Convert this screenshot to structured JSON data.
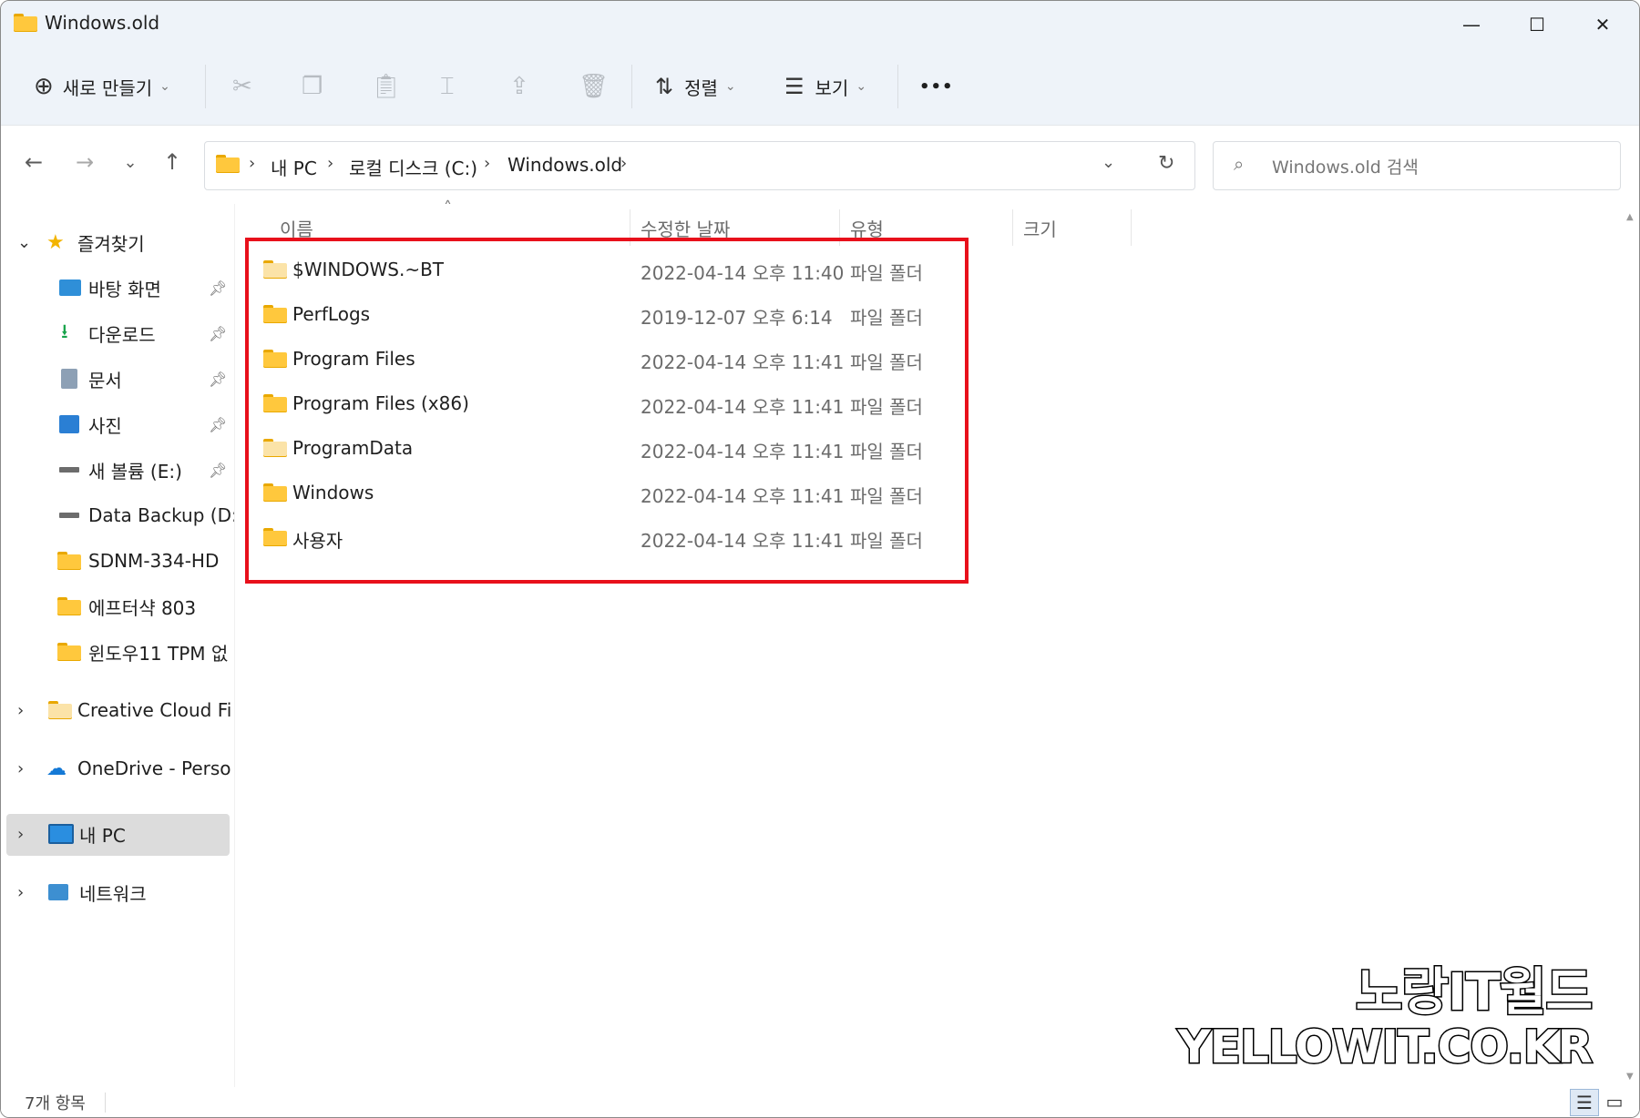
{
  "window": {
    "title": "Windows.old",
    "minimize": "—",
    "maximize": "☐",
    "close": "✕"
  },
  "toolbar": {
    "new_label": "새로 만들기",
    "sort_label": "정렬",
    "view_label": "보기",
    "more_label": "•••"
  },
  "nav": {
    "back": "←",
    "forward": "→",
    "recent": "⌄",
    "up": "↑"
  },
  "address": {
    "segments": [
      "내 PC",
      "로컬 디스크 (C:)",
      "Windows.old"
    ],
    "separator": "›"
  },
  "search": {
    "placeholder": "Windows.old 검색"
  },
  "sidebar": {
    "favorites_label": "즐겨찾기",
    "items": [
      {
        "label": "바탕 화면",
        "icon": "desktop-icon",
        "pinned": true
      },
      {
        "label": "다운로드",
        "icon": "download-icon",
        "pinned": true
      },
      {
        "label": "문서",
        "icon": "document-icon",
        "pinned": true
      },
      {
        "label": "사진",
        "icon": "pictures-icon",
        "pinned": true
      },
      {
        "label": "새 볼륨 (E:)",
        "icon": "drive-icon",
        "pinned": true
      },
      {
        "label": "Data Backup (D:)",
        "icon": "drive-icon",
        "pinned": false
      },
      {
        "label": "SDNM-334-HD",
        "icon": "folder-icon",
        "pinned": false
      },
      {
        "label": "에프터샥 803",
        "icon": "folder-icon",
        "pinned": false
      },
      {
        "label": "윈도우11 TPM 없",
        "icon": "folder-icon",
        "pinned": false
      }
    ],
    "creative_cloud": "Creative Cloud Files",
    "onedrive": "OneDrive - Persona",
    "this_pc": "내 PC",
    "network": "네트워크"
  },
  "columns": {
    "name": "이름",
    "modified": "수정한 날짜",
    "type": "유형",
    "size": "크기"
  },
  "files": [
    {
      "name": "$WINDOWS.~BT",
      "modified": "2022-04-14 오후 11:40",
      "type": "파일 폴더"
    },
    {
      "name": "PerfLogs",
      "modified": "2019-12-07 오후 6:14",
      "type": "파일 폴더"
    },
    {
      "name": "Program Files",
      "modified": "2022-04-14 오후 11:41",
      "type": "파일 폴더"
    },
    {
      "name": "Program Files (x86)",
      "modified": "2022-04-14 오후 11:41",
      "type": "파일 폴더"
    },
    {
      "name": "ProgramData",
      "modified": "2022-04-14 오후 11:41",
      "type": "파일 폴더"
    },
    {
      "name": "Windows",
      "modified": "2022-04-14 오후 11:41",
      "type": "파일 폴더"
    },
    {
      "name": "사용자",
      "modified": "2022-04-14 오후 11:41",
      "type": "파일 폴더"
    }
  ],
  "status": {
    "item_count": "7개 항목"
  },
  "watermark": {
    "line1": "노랑IT월드",
    "line2": "YELLOWIT.CO.KR"
  },
  "colors": {
    "highlight_box": "#e8101b",
    "folder": "#ffc83d",
    "titlebar": "#eef3f9",
    "selected_nav": "#dcdcdc"
  }
}
